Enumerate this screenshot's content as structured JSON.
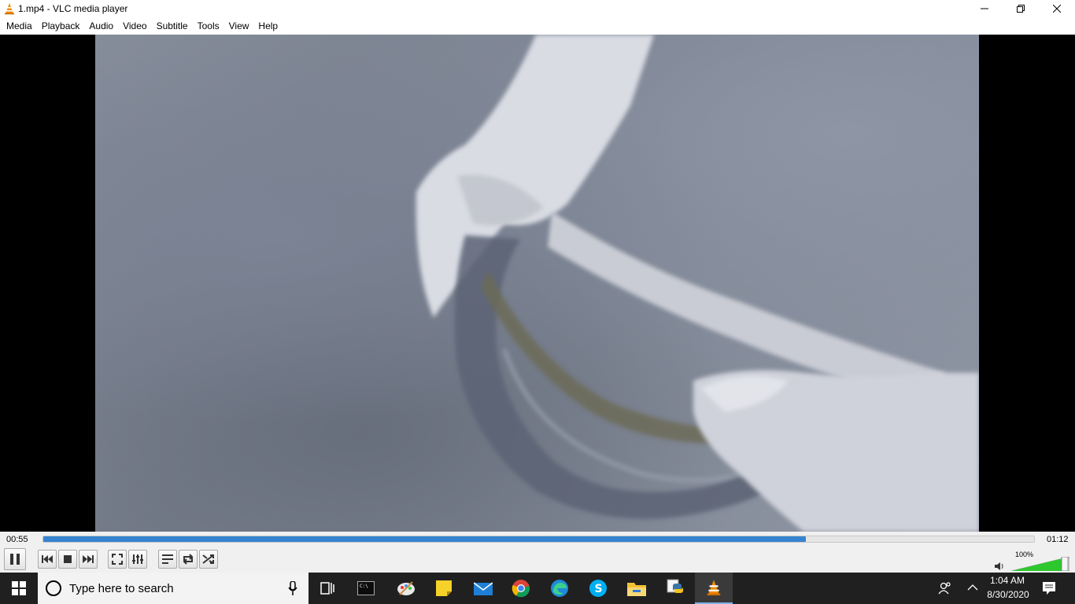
{
  "window": {
    "title": "1.mp4 - VLC media player"
  },
  "menu": {
    "items": [
      "Media",
      "Playback",
      "Audio",
      "Video",
      "Subtitle",
      "Tools",
      "View",
      "Help"
    ]
  },
  "player": {
    "elapsed": "00:55",
    "total": "01:12",
    "progress_fraction": 0.77,
    "volume_label": "100%",
    "volume_fraction": 1.0
  },
  "taskbar": {
    "search_placeholder": "Type here to search",
    "time": "1:04 AM",
    "date": "8/30/2020",
    "pinned": [
      "task-view-icon",
      "terminal-icon",
      "paint-icon",
      "sticky-notes-icon",
      "mail-icon",
      "chrome-icon",
      "edge-icon",
      "skype-icon",
      "file-explorer-icon",
      "python-icon",
      "vlc-icon"
    ]
  },
  "colors": {
    "accent": "#3683d1",
    "vlc_orange": "#f08a00",
    "volume_green": "#2ec72e",
    "taskbar": "#202020"
  }
}
